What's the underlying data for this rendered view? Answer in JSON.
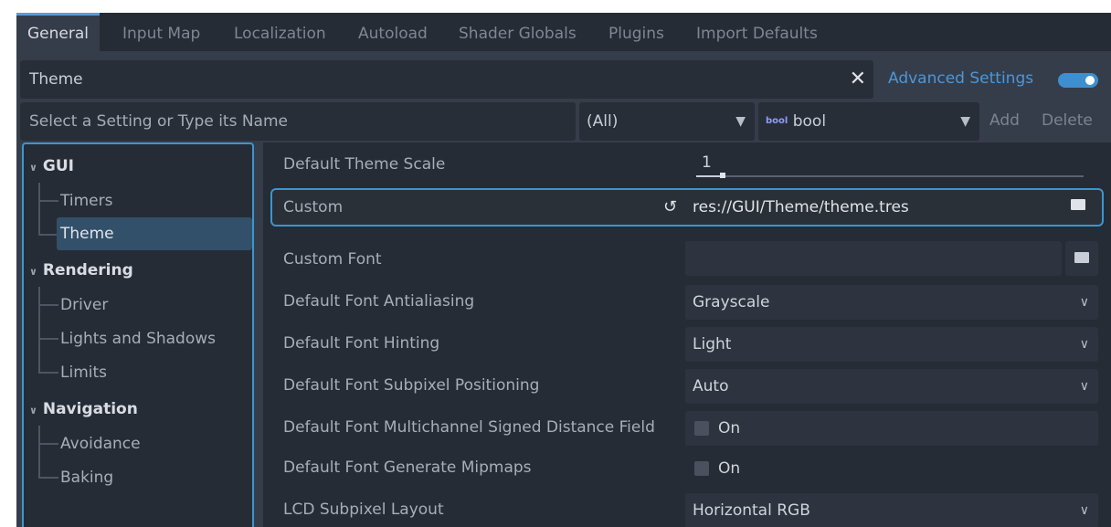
{
  "tabs": [
    "General",
    "Input Map",
    "Localization",
    "Autoload",
    "Shader Globals",
    "Plugins",
    "Import Defaults"
  ],
  "filter": {
    "value": "Theme",
    "clear_icon": "close-icon",
    "advanced_label": "Advanced Settings",
    "advanced_on": true
  },
  "addbar": {
    "placeholder": "Select a Setting or Type its Name",
    "scope": "(All)",
    "type_badge": "bool",
    "type": "bool",
    "add_label": "Add",
    "delete_label": "Delete"
  },
  "tree": {
    "gui": "GUI",
    "gui_items": [
      "Timers",
      "Theme"
    ],
    "rendering": "Rendering",
    "rendering_items": [
      "Driver",
      "Lights and Shadows",
      "Limits"
    ],
    "navigation": "Navigation",
    "navigation_items": [
      "Avoidance",
      "Baking"
    ]
  },
  "props": [
    {
      "label": "Default Theme Scale",
      "value": "1"
    },
    {
      "label": "Custom",
      "value": "res://GUI/Theme/theme.tres"
    },
    {
      "label": "Custom Font",
      "value": ""
    },
    {
      "label": "Default Font Antialiasing",
      "value": "Grayscale"
    },
    {
      "label": "Default Font Hinting",
      "value": "Light"
    },
    {
      "label": "Default Font Subpixel Positioning",
      "value": "Auto"
    },
    {
      "label": "Default Font Multichannel Signed Distance Field",
      "value": "On"
    },
    {
      "label": "Default Font Generate Mipmaps",
      "value": "On"
    },
    {
      "label": "LCD Subpixel Layout",
      "value": "Horizontal RGB"
    }
  ],
  "colors": {
    "accent": "#3a96d0",
    "panel": "#262c36"
  }
}
